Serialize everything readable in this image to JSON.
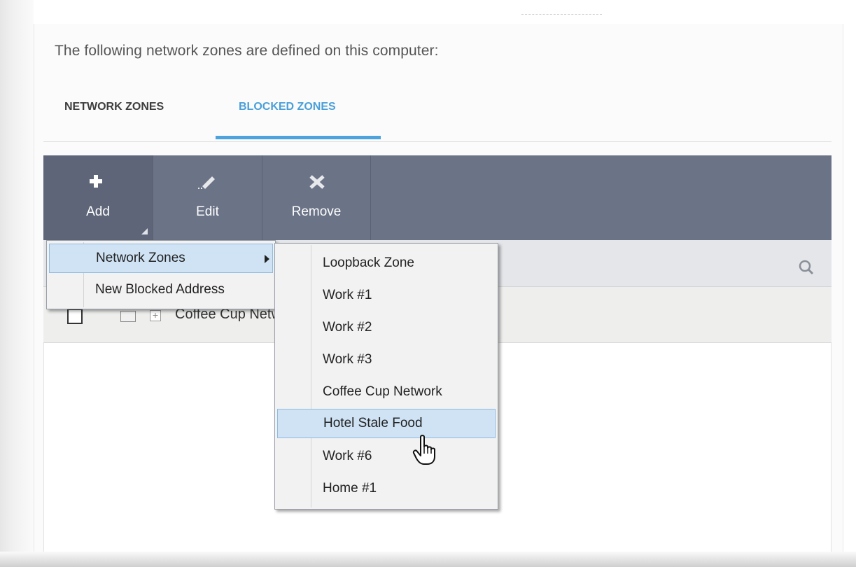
{
  "heading": "The following network zones are defined on this computer:",
  "tabs": [
    {
      "label": "NETWORK ZONES",
      "active": false
    },
    {
      "label": "BLOCKED ZONES",
      "active": true
    }
  ],
  "toolbar": {
    "add": {
      "label": "Add",
      "icon": "plus-icon"
    },
    "edit": {
      "label": "Edit",
      "icon": "pencil-icon"
    },
    "remove": {
      "label": "Remove",
      "icon": "x-icon"
    }
  },
  "table": {
    "search_icon": "search-icon",
    "rows": [
      {
        "name": "Coffee Cup Network"
      }
    ]
  },
  "add_menu": {
    "items": [
      {
        "label": "Network Zones",
        "has_submenu": true,
        "highlighted": true
      },
      {
        "label": "New Blocked Address",
        "has_submenu": false,
        "highlighted": false
      }
    ]
  },
  "zones_submenu": {
    "items": [
      {
        "label": "Loopback Zone"
      },
      {
        "label": "Work #1"
      },
      {
        "label": "Work #2"
      },
      {
        "label": "Work #3"
      },
      {
        "label": "Coffee Cup Network"
      },
      {
        "label": "Hotel Stale Food",
        "highlighted": true
      },
      {
        "label": "Work #6"
      },
      {
        "label": "Home #1"
      }
    ]
  },
  "colors": {
    "toolbar": "#6b7386",
    "accent": "#4ca3dd",
    "menu_highlight": "#cfe3f5"
  }
}
